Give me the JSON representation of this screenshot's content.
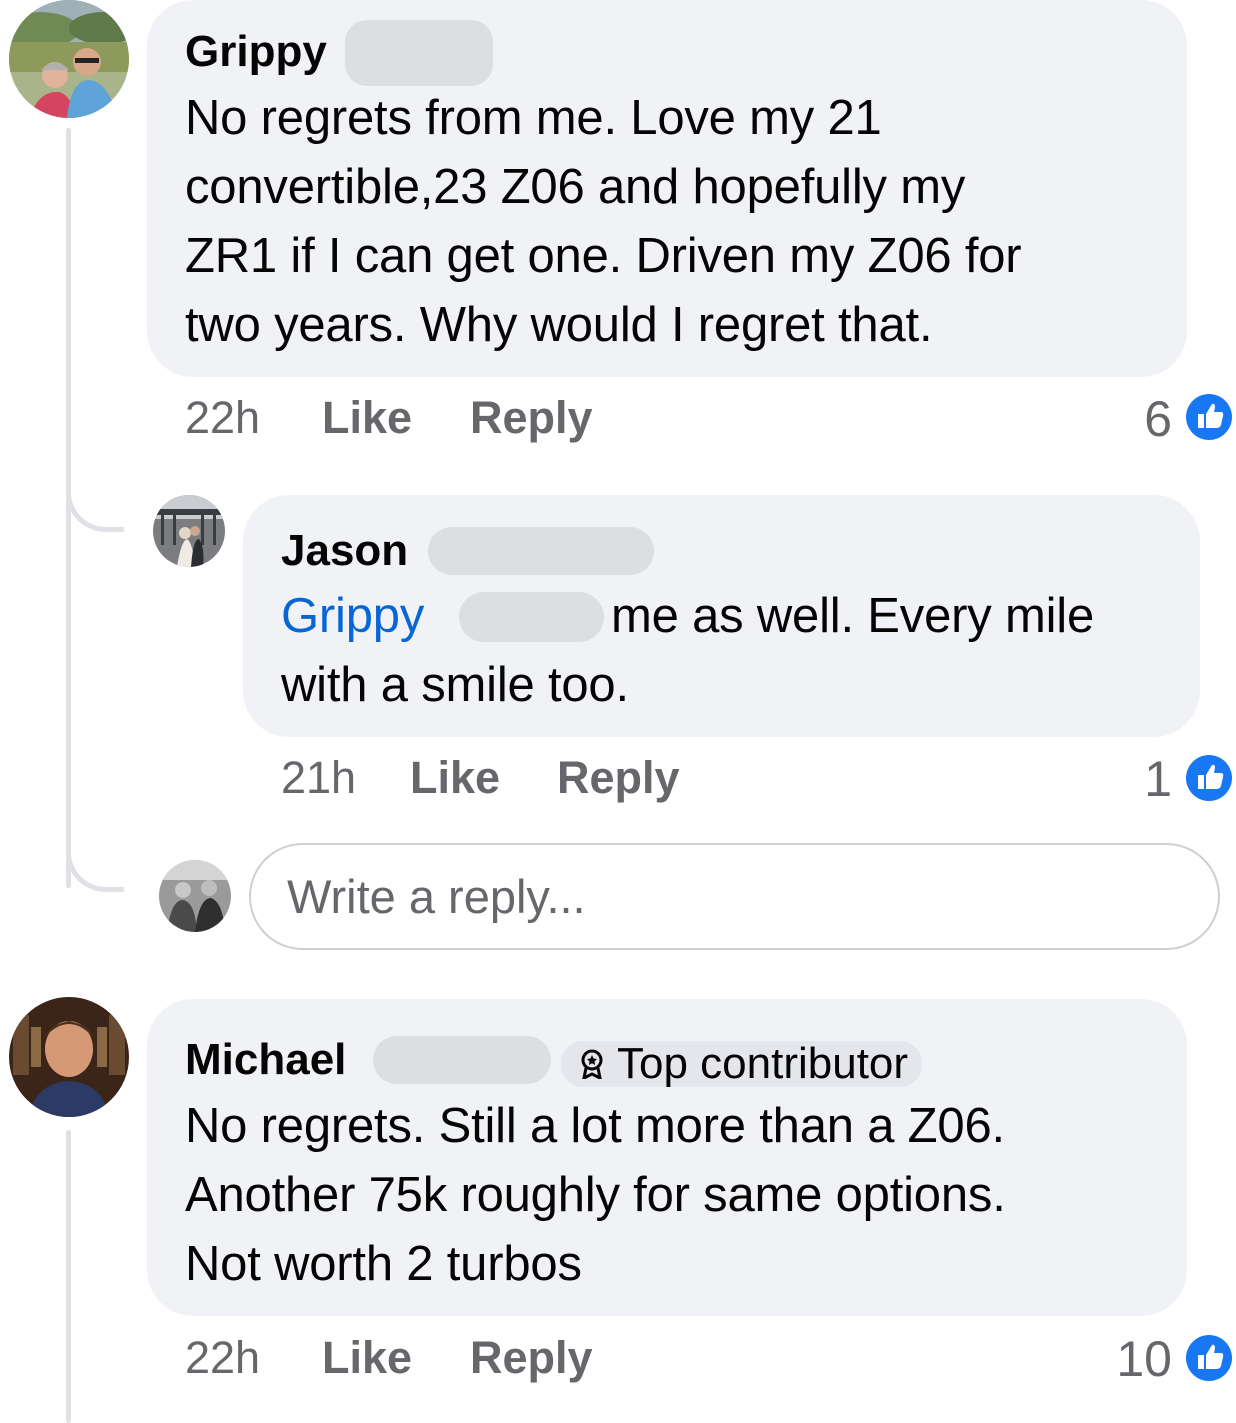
{
  "colors": {
    "bubble_bg": "#f0f2f5",
    "mention": "#0866d4",
    "meta_text": "#65676b",
    "like_blue": "#1877f2"
  },
  "comments": [
    {
      "author": "Grippy",
      "text_lines": [
        "No regrets from me. Love my 21",
        "convertible,23 Z06 and hopefully my",
        "ZR1 if I can get one. Driven my Z06 for",
        "two years. Why would I regret that."
      ],
      "time": "22h",
      "like_label": "Like",
      "reply_label": "Reply",
      "reaction_count": "6",
      "reaction_icon": "thumbs-up-icon",
      "replies": [
        {
          "author": "Jason",
          "mention": "Grippy",
          "text_after_mention": "me as well. Every mile",
          "text_line_2": "with a smile too.",
          "time": "21h",
          "like_label": "Like",
          "reply_label": "Reply",
          "reaction_count": "1",
          "reaction_icon": "thumbs-up-icon"
        }
      ],
      "reply_input": {
        "placeholder": "Write a reply..."
      }
    },
    {
      "author": "Michael",
      "badge": "Top contributor",
      "badge_icon": "award-icon",
      "text_lines": [
        "No regrets. Still a lot more than a Z06.",
        "Another 75k roughly for same options.",
        "Not worth 2 turbos"
      ],
      "time": "22h",
      "like_label": "Like",
      "reply_label": "Reply",
      "reaction_count": "10",
      "reaction_icon": "thumbs-up-icon"
    }
  ]
}
